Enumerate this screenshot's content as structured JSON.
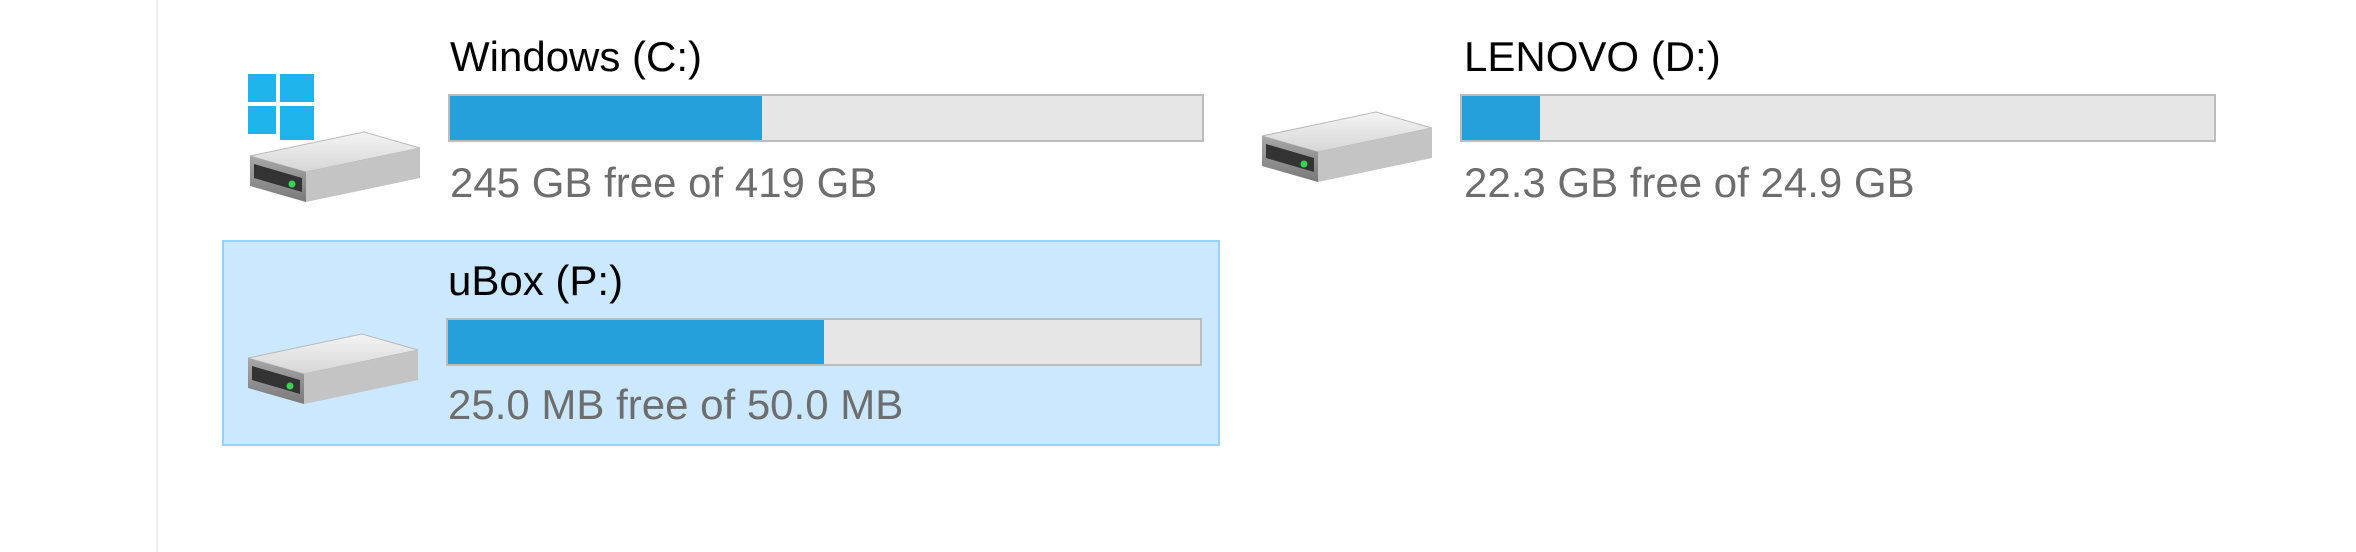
{
  "accent_color": "#26a0da",
  "selection_color": "#cce8ff",
  "drives": [
    {
      "name": "Windows (C:)",
      "free_text": "245 GB free of 419 GB",
      "used_fraction": 0.415,
      "icon": "windows-system-drive-icon",
      "selected": false
    },
    {
      "name": "LENOVO (D:)",
      "free_text": "22.3 GB free of 24.9 GB",
      "used_fraction": 0.104,
      "icon": "hard-drive-icon",
      "selected": false
    },
    {
      "name": "uBox (P:)",
      "free_text": "25.0 MB free of 50.0 MB",
      "used_fraction": 0.5,
      "icon": "hard-drive-icon",
      "selected": true
    }
  ]
}
